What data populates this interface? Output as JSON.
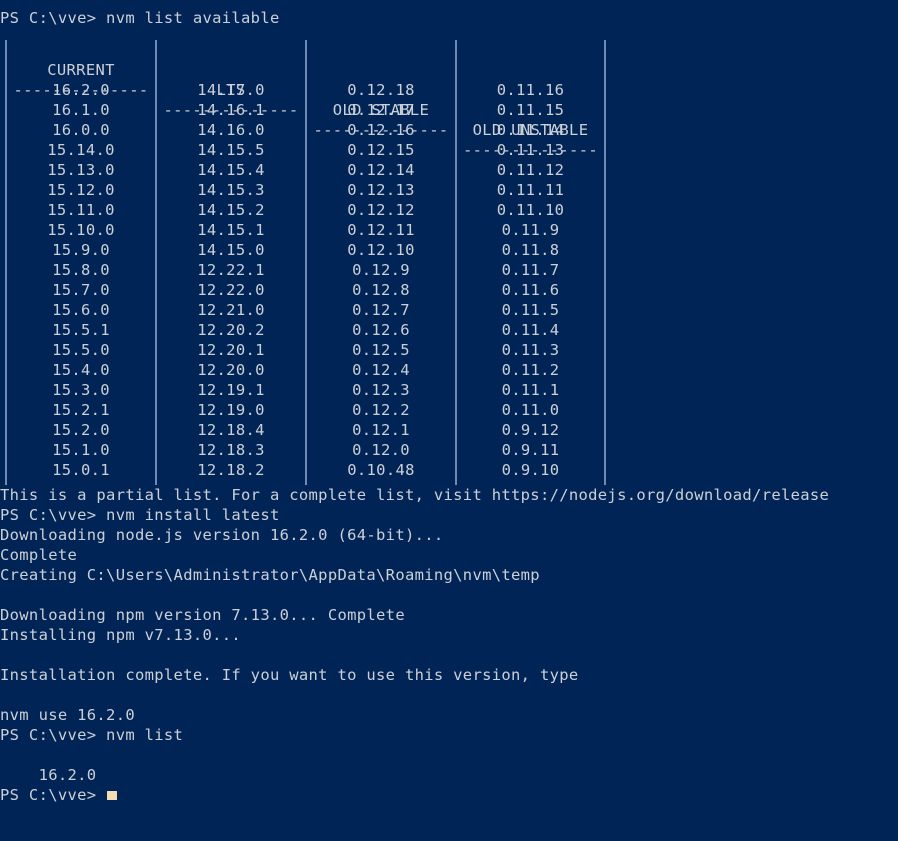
{
  "terminal": {
    "background_color": "#012456",
    "text_color": "#cbd0d6",
    "cursor_color": "#f5dcb4",
    "separator_color": "#6f8bb5",
    "prompt": "PS C:\\vve>"
  },
  "command_line_1": "PS C:\\vve> nvm list available",
  "table": {
    "headers": [
      "CURRENT",
      "LTS",
      "OLD STABLE",
      "OLD UNSTABLE"
    ],
    "divider": "--------------",
    "rows": [
      [
        "16.2.0",
        "14.17.0",
        "0.12.18",
        "0.11.16"
      ],
      [
        "16.1.0",
        "14.16.1",
        "0.12.17",
        "0.11.15"
      ],
      [
        "16.0.0",
        "14.16.0",
        "0.12.16",
        "0.11.14"
      ],
      [
        "15.14.0",
        "14.15.5",
        "0.12.15",
        "0.11.13"
      ],
      [
        "15.13.0",
        "14.15.4",
        "0.12.14",
        "0.11.12"
      ],
      [
        "15.12.0",
        "14.15.3",
        "0.12.13",
        "0.11.11"
      ],
      [
        "15.11.0",
        "14.15.2",
        "0.12.12",
        "0.11.10"
      ],
      [
        "15.10.0",
        "14.15.1",
        "0.12.11",
        "0.11.9"
      ],
      [
        "15.9.0",
        "14.15.0",
        "0.12.10",
        "0.11.8"
      ],
      [
        "15.8.0",
        "12.22.1",
        "0.12.9",
        "0.11.7"
      ],
      [
        "15.7.0",
        "12.22.0",
        "0.12.8",
        "0.11.6"
      ],
      [
        "15.6.0",
        "12.21.0",
        "0.12.7",
        "0.11.5"
      ],
      [
        "15.5.1",
        "12.20.2",
        "0.12.6",
        "0.11.4"
      ],
      [
        "15.5.0",
        "12.20.1",
        "0.12.5",
        "0.11.3"
      ],
      [
        "15.4.0",
        "12.20.0",
        "0.12.4",
        "0.11.2"
      ],
      [
        "15.3.0",
        "12.19.1",
        "0.12.3",
        "0.11.1"
      ],
      [
        "15.2.1",
        "12.19.0",
        "0.12.2",
        "0.11.0"
      ],
      [
        "15.2.0",
        "12.18.4",
        "0.12.1",
        "0.9.12"
      ],
      [
        "15.1.0",
        "12.18.3",
        "0.12.0",
        "0.9.11"
      ],
      [
        "15.0.1",
        "12.18.2",
        "0.10.48",
        "0.9.10"
      ]
    ]
  },
  "output": {
    "partial_list_note": "This is a partial list. For a complete list, visit https://nodejs.org/download/release",
    "command_line_2": "PS C:\\vve> nvm install latest",
    "downloading_node": "Downloading node.js version 16.2.0 (64-bit)...",
    "complete": "Complete",
    "creating_temp": "Creating C:\\Users\\Administrator\\AppData\\Roaming\\nvm\\temp",
    "downloading_npm": "Downloading npm version 7.13.0... Complete",
    "installing_npm": "Installing npm v7.13.0...",
    "installation_complete": "Installation complete. If you want to use this version, type",
    "nvm_use_hint": "nvm use 16.2.0",
    "command_line_3": "PS C:\\vve> nvm list",
    "installed_version": "    16.2.0",
    "final_prompt": "PS C:\\vve> "
  }
}
